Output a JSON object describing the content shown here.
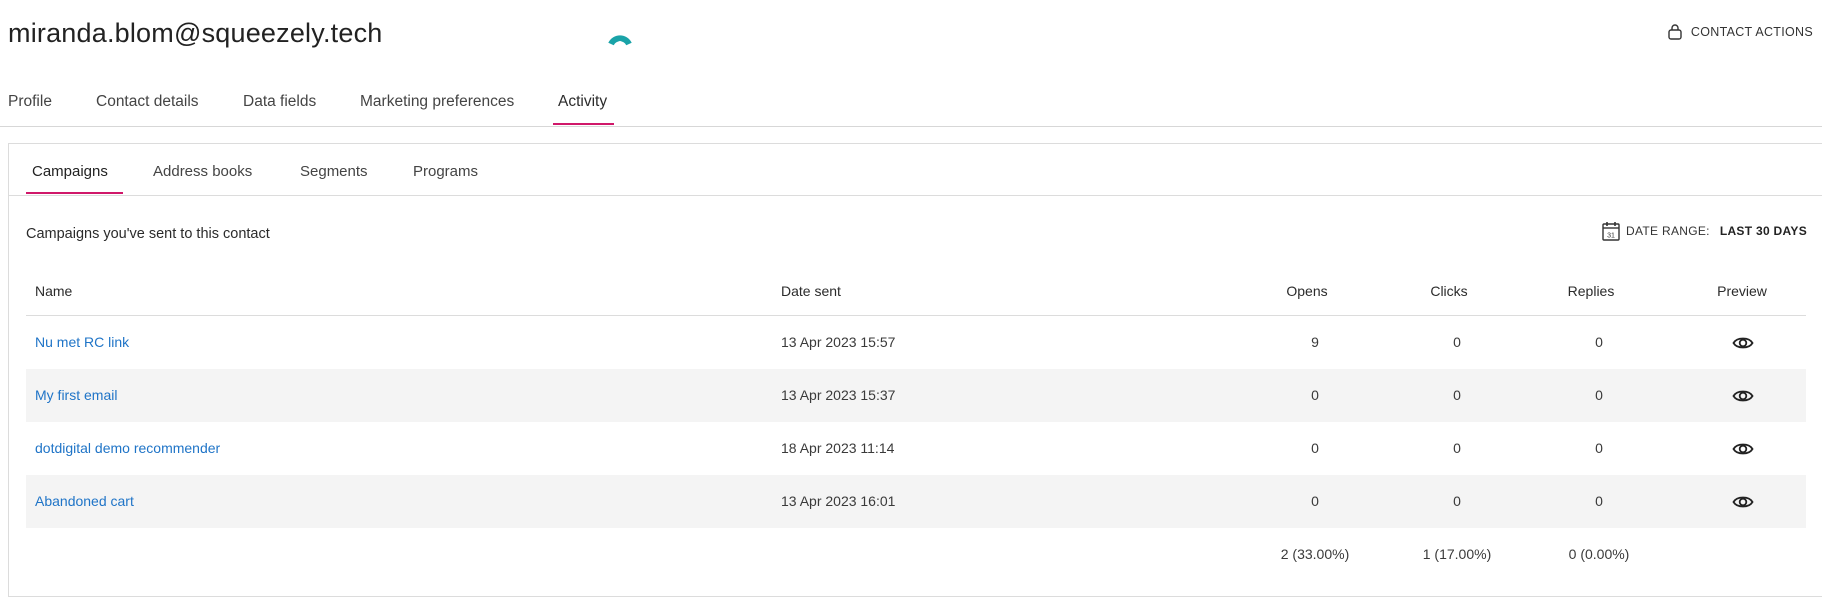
{
  "header": {
    "email": "miranda.blom@squeezely.tech",
    "contact_actions_label": "CONTACT ACTIONS",
    "icons": {
      "loader": "spinner-icon",
      "contact_actions": "lock-icon"
    }
  },
  "main_tabs": [
    {
      "label": "Profile"
    },
    {
      "label": "Contact details"
    },
    {
      "label": "Data fields"
    },
    {
      "label": "Marketing preferences"
    },
    {
      "label": "Activity",
      "active": true
    }
  ],
  "sub_tabs": [
    {
      "label": "Campaigns",
      "active": true
    },
    {
      "label": "Address books"
    },
    {
      "label": "Segments"
    },
    {
      "label": "Programs"
    }
  ],
  "section": {
    "title": "Campaigns you've sent to this contact",
    "date_range_label": "DATE RANGE:",
    "date_range_value": "LAST 30 DAYS",
    "date_range_icon": "calendar-icon",
    "calendar_day": "31"
  },
  "table": {
    "columns": [
      "Name",
      "Date sent",
      "Opens",
      "Clicks",
      "Replies",
      "Preview"
    ],
    "rows": [
      {
        "name": "Nu met RC link",
        "date": "13 Apr 2023 15:57",
        "opens": "9",
        "clicks": "0",
        "replies": "0"
      },
      {
        "name": "My first email",
        "date": "13 Apr 2023 15:37",
        "opens": "0",
        "clicks": "0",
        "replies": "0"
      },
      {
        "name": "dotdigital demo recommender",
        "date": "18 Apr 2023 11:14",
        "opens": "0",
        "clicks": "0",
        "replies": "0"
      },
      {
        "name": "Abandoned cart",
        "date": "13 Apr 2023 16:01",
        "opens": "0",
        "clicks": "0",
        "replies": "0"
      }
    ],
    "totals": {
      "opens": "2 (33.00%)",
      "clicks": "1 (17.00%)",
      "replies": "0 (0.00%)"
    },
    "preview_icon": "eye-icon"
  },
  "colors": {
    "accent": "#d0186a",
    "link": "#1f74c7",
    "stripe": "#f4f4f4",
    "loader": "#1aa3a8"
  }
}
